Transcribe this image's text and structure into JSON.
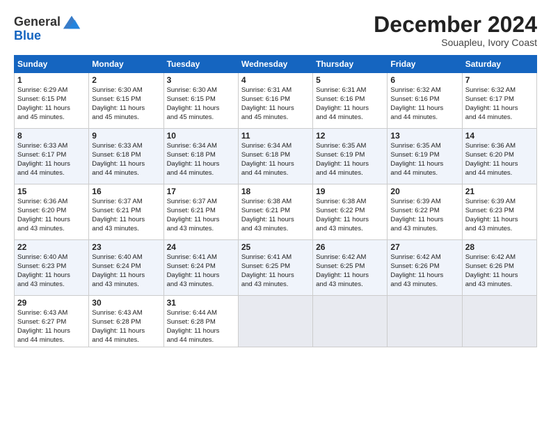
{
  "header": {
    "logo_line1": "General",
    "logo_line2": "Blue",
    "month_title": "December 2024",
    "location": "Souapleu, Ivory Coast"
  },
  "days_of_week": [
    "Sunday",
    "Monday",
    "Tuesday",
    "Wednesday",
    "Thursday",
    "Friday",
    "Saturday"
  ],
  "weeks": [
    [
      {
        "day": "1",
        "lines": [
          "Sunrise: 6:29 AM",
          "Sunset: 6:15 PM",
          "Daylight: 11 hours",
          "and 45 minutes."
        ]
      },
      {
        "day": "2",
        "lines": [
          "Sunrise: 6:30 AM",
          "Sunset: 6:15 PM",
          "Daylight: 11 hours",
          "and 45 minutes."
        ]
      },
      {
        "day": "3",
        "lines": [
          "Sunrise: 6:30 AM",
          "Sunset: 6:15 PM",
          "Daylight: 11 hours",
          "and 45 minutes."
        ]
      },
      {
        "day": "4",
        "lines": [
          "Sunrise: 6:31 AM",
          "Sunset: 6:16 PM",
          "Daylight: 11 hours",
          "and 45 minutes."
        ]
      },
      {
        "day": "5",
        "lines": [
          "Sunrise: 6:31 AM",
          "Sunset: 6:16 PM",
          "Daylight: 11 hours",
          "and 44 minutes."
        ]
      },
      {
        "day": "6",
        "lines": [
          "Sunrise: 6:32 AM",
          "Sunset: 6:16 PM",
          "Daylight: 11 hours",
          "and 44 minutes."
        ]
      },
      {
        "day": "7",
        "lines": [
          "Sunrise: 6:32 AM",
          "Sunset: 6:17 PM",
          "Daylight: 11 hours",
          "and 44 minutes."
        ]
      }
    ],
    [
      {
        "day": "8",
        "lines": [
          "Sunrise: 6:33 AM",
          "Sunset: 6:17 PM",
          "Daylight: 11 hours",
          "and 44 minutes."
        ]
      },
      {
        "day": "9",
        "lines": [
          "Sunrise: 6:33 AM",
          "Sunset: 6:18 PM",
          "Daylight: 11 hours",
          "and 44 minutes."
        ]
      },
      {
        "day": "10",
        "lines": [
          "Sunrise: 6:34 AM",
          "Sunset: 6:18 PM",
          "Daylight: 11 hours",
          "and 44 minutes."
        ]
      },
      {
        "day": "11",
        "lines": [
          "Sunrise: 6:34 AM",
          "Sunset: 6:18 PM",
          "Daylight: 11 hours",
          "and 44 minutes."
        ]
      },
      {
        "day": "12",
        "lines": [
          "Sunrise: 6:35 AM",
          "Sunset: 6:19 PM",
          "Daylight: 11 hours",
          "and 44 minutes."
        ]
      },
      {
        "day": "13",
        "lines": [
          "Sunrise: 6:35 AM",
          "Sunset: 6:19 PM",
          "Daylight: 11 hours",
          "and 44 minutes."
        ]
      },
      {
        "day": "14",
        "lines": [
          "Sunrise: 6:36 AM",
          "Sunset: 6:20 PM",
          "Daylight: 11 hours",
          "and 44 minutes."
        ]
      }
    ],
    [
      {
        "day": "15",
        "lines": [
          "Sunrise: 6:36 AM",
          "Sunset: 6:20 PM",
          "Daylight: 11 hours",
          "and 43 minutes."
        ]
      },
      {
        "day": "16",
        "lines": [
          "Sunrise: 6:37 AM",
          "Sunset: 6:21 PM",
          "Daylight: 11 hours",
          "and 43 minutes."
        ]
      },
      {
        "day": "17",
        "lines": [
          "Sunrise: 6:37 AM",
          "Sunset: 6:21 PM",
          "Daylight: 11 hours",
          "and 43 minutes."
        ]
      },
      {
        "day": "18",
        "lines": [
          "Sunrise: 6:38 AM",
          "Sunset: 6:21 PM",
          "Daylight: 11 hours",
          "and 43 minutes."
        ]
      },
      {
        "day": "19",
        "lines": [
          "Sunrise: 6:38 AM",
          "Sunset: 6:22 PM",
          "Daylight: 11 hours",
          "and 43 minutes."
        ]
      },
      {
        "day": "20",
        "lines": [
          "Sunrise: 6:39 AM",
          "Sunset: 6:22 PM",
          "Daylight: 11 hours",
          "and 43 minutes."
        ]
      },
      {
        "day": "21",
        "lines": [
          "Sunrise: 6:39 AM",
          "Sunset: 6:23 PM",
          "Daylight: 11 hours",
          "and 43 minutes."
        ]
      }
    ],
    [
      {
        "day": "22",
        "lines": [
          "Sunrise: 6:40 AM",
          "Sunset: 6:23 PM",
          "Daylight: 11 hours",
          "and 43 minutes."
        ]
      },
      {
        "day": "23",
        "lines": [
          "Sunrise: 6:40 AM",
          "Sunset: 6:24 PM",
          "Daylight: 11 hours",
          "and 43 minutes."
        ]
      },
      {
        "day": "24",
        "lines": [
          "Sunrise: 6:41 AM",
          "Sunset: 6:24 PM",
          "Daylight: 11 hours",
          "and 43 minutes."
        ]
      },
      {
        "day": "25",
        "lines": [
          "Sunrise: 6:41 AM",
          "Sunset: 6:25 PM",
          "Daylight: 11 hours",
          "and 43 minutes."
        ]
      },
      {
        "day": "26",
        "lines": [
          "Sunrise: 6:42 AM",
          "Sunset: 6:25 PM",
          "Daylight: 11 hours",
          "and 43 minutes."
        ]
      },
      {
        "day": "27",
        "lines": [
          "Sunrise: 6:42 AM",
          "Sunset: 6:26 PM",
          "Daylight: 11 hours",
          "and 43 minutes."
        ]
      },
      {
        "day": "28",
        "lines": [
          "Sunrise: 6:42 AM",
          "Sunset: 6:26 PM",
          "Daylight: 11 hours",
          "and 43 minutes."
        ]
      }
    ],
    [
      {
        "day": "29",
        "lines": [
          "Sunrise: 6:43 AM",
          "Sunset: 6:27 PM",
          "Daylight: 11 hours",
          "and 44 minutes."
        ]
      },
      {
        "day": "30",
        "lines": [
          "Sunrise: 6:43 AM",
          "Sunset: 6:28 PM",
          "Daylight: 11 hours",
          "and 44 minutes."
        ]
      },
      {
        "day": "31",
        "lines": [
          "Sunrise: 6:44 AM",
          "Sunset: 6:28 PM",
          "Daylight: 11 hours",
          "and 44 minutes."
        ]
      },
      {
        "day": "",
        "lines": []
      },
      {
        "day": "",
        "lines": []
      },
      {
        "day": "",
        "lines": []
      },
      {
        "day": "",
        "lines": []
      }
    ]
  ]
}
